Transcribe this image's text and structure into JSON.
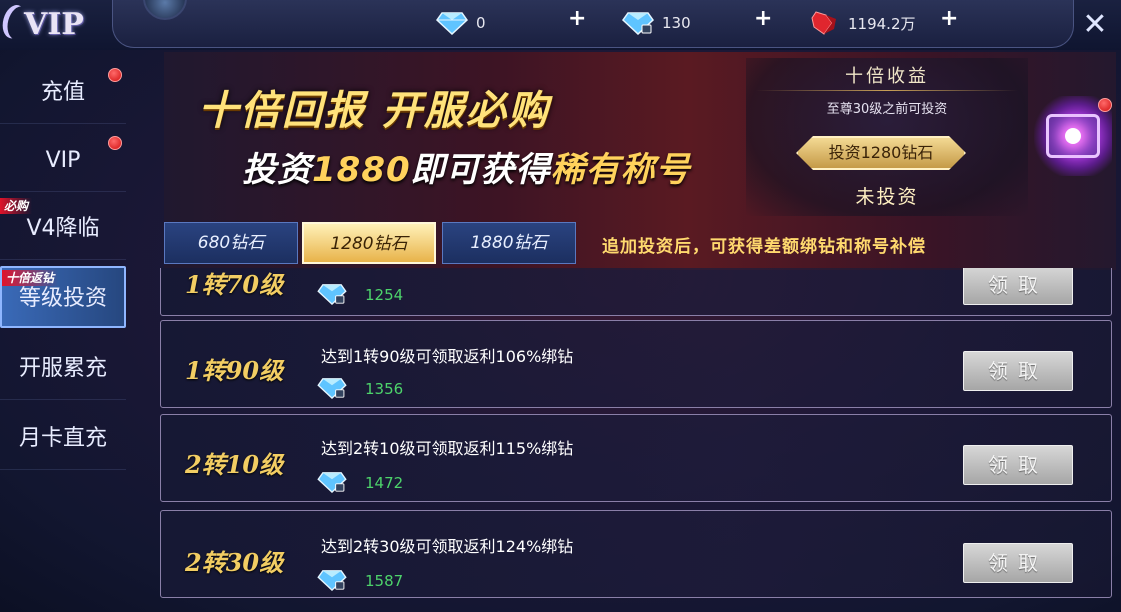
{
  "header": {
    "logo_text": "VIP",
    "currencies": [
      {
        "icon": "diamond-icon",
        "value": "0"
      },
      {
        "icon": "bound-diamond-icon",
        "value": "130"
      },
      {
        "icon": "red-crystal-icon",
        "value": "1194.2万"
      }
    ],
    "plus_label": "+",
    "close_icon": "close-icon"
  },
  "sidebar": {
    "items": [
      {
        "label": "充值",
        "tag": "",
        "dot": true
      },
      {
        "label": "VIP",
        "tag": "",
        "dot": true
      },
      {
        "label": "V4降临",
        "tag": "必购",
        "dot": false
      },
      {
        "label": "等级投资",
        "tag": "十倍返钻",
        "dot": true,
        "active": true
      },
      {
        "label": "开服累充",
        "tag": "",
        "dot": false
      },
      {
        "label": "月卡直充",
        "tag": "",
        "dot": false
      }
    ]
  },
  "banner": {
    "title": "十倍回报 开服必购",
    "subtitle_pre": "投资",
    "subtitle_num": "1880",
    "subtitle_mid": "即可获得",
    "subtitle_hl": "稀有称号",
    "panel_title": "十倍收益",
    "panel_note": "至尊30级之前可投资",
    "invest_button": "投资1280钻石",
    "status": "未投资"
  },
  "tabs": [
    {
      "label": "680钻石",
      "active": false
    },
    {
      "label": "1280钻石",
      "active": true
    },
    {
      "label": "1880钻石",
      "active": false
    }
  ],
  "tab_note": "追加投资后，可获得差额绑钻和称号补偿",
  "rewards": [
    {
      "level": "1转70级",
      "desc": "",
      "amount": "1254",
      "claim": "领取"
    },
    {
      "level": "1转90级",
      "desc": "达到1转90级可领取返利106%绑钻",
      "amount": "1356",
      "claim": "领取"
    },
    {
      "level": "2转10级",
      "desc": "达到2转10级可领取返利115%绑钻",
      "amount": "1472",
      "claim": "领取"
    },
    {
      "level": "2转30级",
      "desc": "达到2转30级可领取返利124%绑钻",
      "amount": "1587",
      "claim": "领取"
    }
  ],
  "colors": {
    "gold": "#f2cd63",
    "amount_green": "#4dd36b",
    "notice_red": "#d10f0f",
    "tab_active": "#e8b34a"
  }
}
